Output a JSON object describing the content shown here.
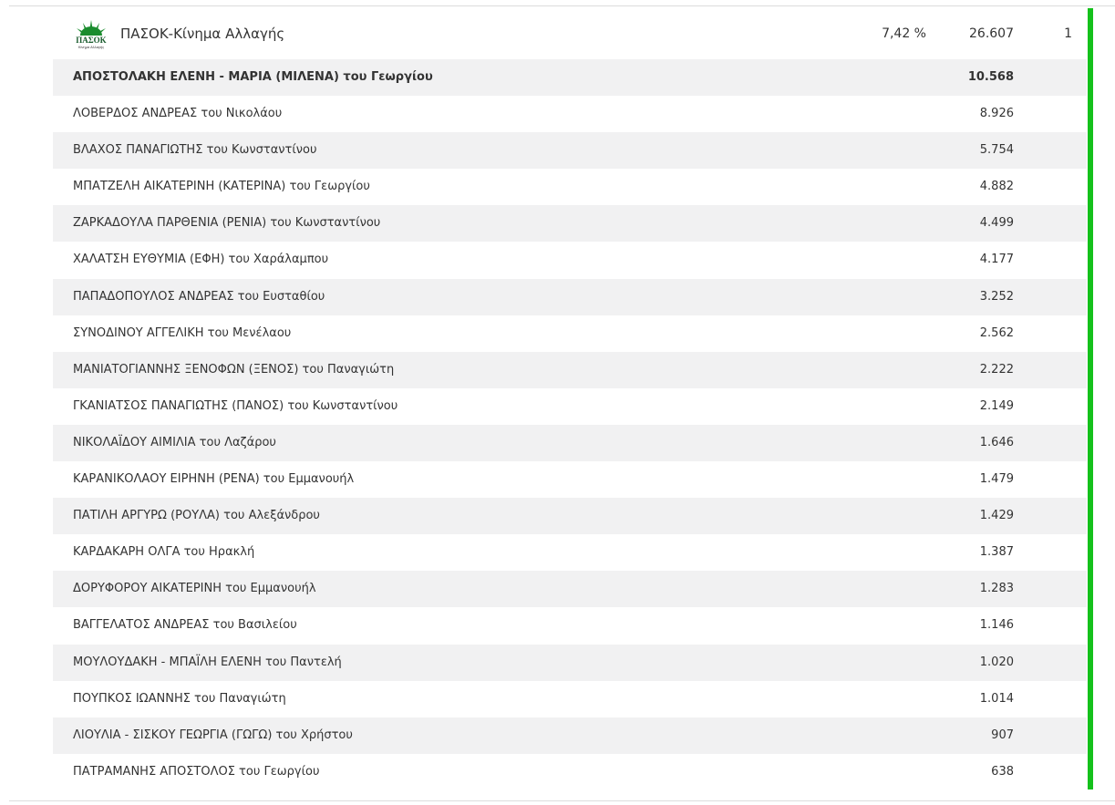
{
  "party": {
    "name": "ΠΑΣΟΚ-Κίνημα Αλλαγής",
    "percent": "7,42 %",
    "votes": "26.607",
    "seats": "1",
    "logo_text": "ΠΑΣΟΚ",
    "logo_subtext": "Κίνημα Αλλαγής",
    "accent_color": "#14c11b"
  },
  "candidates": [
    {
      "name": "ΑΠΟΣΤΟΛΑΚΗ ΕΛΕΝΗ - ΜΑΡΙΑ (ΜΙΛΕΝΑ) του Γεωργίου",
      "votes": "10.568"
    },
    {
      "name": "ΛΟΒΕΡΔΟΣ ΑΝΔΡΕΑΣ του Νικολάου",
      "votes": "8.926"
    },
    {
      "name": "ΒΛΑΧΟΣ ΠΑΝΑΓΙΩΤΗΣ του Κωνσταντίνου",
      "votes": "5.754"
    },
    {
      "name": "ΜΠΑΤΖΕΛΗ ΑΙΚΑΤΕΡΙΝΗ (ΚΑΤΕΡΙΝΑ) του Γεωργίου",
      "votes": "4.882"
    },
    {
      "name": "ΖΑΡΚΑΔΟΥΛΑ ΠΑΡΘΕΝΙΑ (ΡΕΝΙΑ) του Κωνσταντίνου",
      "votes": "4.499"
    },
    {
      "name": "ΧΑΛΑΤΣΗ ΕΥΘΥΜΙΑ (ΕΦΗ) του Χαράλαμπου",
      "votes": "4.177"
    },
    {
      "name": "ΠΑΠΑΔΟΠΟΥΛΟΣ ΑΝΔΡΕΑΣ του Ευσταθίου",
      "votes": "3.252"
    },
    {
      "name": "ΣΥΝΟΔΙΝΟΥ ΑΓΓΕΛΙΚΗ του Μενέλαου",
      "votes": "2.562"
    },
    {
      "name": "ΜΑΝΙΑΤΟΓΙΑΝΝΗΣ ΞΕΝΟΦΩΝ (ΞΕΝΟΣ) του Παναγιώτη",
      "votes": "2.222"
    },
    {
      "name": "ΓΚΑΝΙΑΤΣΟΣ ΠΑΝΑΓΙΩΤΗΣ (ΠΑΝΟΣ) του Κωνσταντίνου",
      "votes": "2.149"
    },
    {
      "name": "ΝΙΚΟΛΑΪΔΟΥ ΑΙΜΙΛΙΑ του Λαζάρου",
      "votes": "1.646"
    },
    {
      "name": "ΚΑΡΑΝΙΚΟΛΑΟΥ ΕΙΡΗΝΗ (ΡΕΝΑ) του Εμμανουήλ",
      "votes": "1.479"
    },
    {
      "name": "ΠΑΤΙΛΗ ΑΡΓΥΡΩ (ΡΟΥΛΑ) του Αλεξάνδρου",
      "votes": "1.429"
    },
    {
      "name": "ΚΑΡΔΑΚΑΡΗ ΟΛΓΑ του Ηρακλή",
      "votes": "1.387"
    },
    {
      "name": "ΔΟΡΥΦΟΡΟΥ ΑΙΚΑΤΕΡΙΝΗ του Εμμανουήλ",
      "votes": "1.283"
    },
    {
      "name": "ΒΑΓΓΕΛΑΤΟΣ ΑΝΔΡΕΑΣ του Βασιλείου",
      "votes": "1.146"
    },
    {
      "name": "ΜΟΥΛΟΥΔΑΚΗ - ΜΠΑΪΛΗ ΕΛΕΝΗ του Παντελή",
      "votes": "1.020"
    },
    {
      "name": "ΠΟΥΠΚΟΣ ΙΩΑΝΝΗΣ του Παναγιώτη",
      "votes": "1.014"
    },
    {
      "name": "ΛΙΟΥΛΙΑ - ΣΙΣΚΟΥ ΓΕΩΡΓΙΑ (ΓΩΓΩ) του Χρήστου",
      "votes": "907"
    },
    {
      "name": "ΠΑΤΡΑΜΑΝΗΣ ΑΠΟΣΤΟΛΟΣ του Γεωργίου",
      "votes": "638"
    }
  ]
}
